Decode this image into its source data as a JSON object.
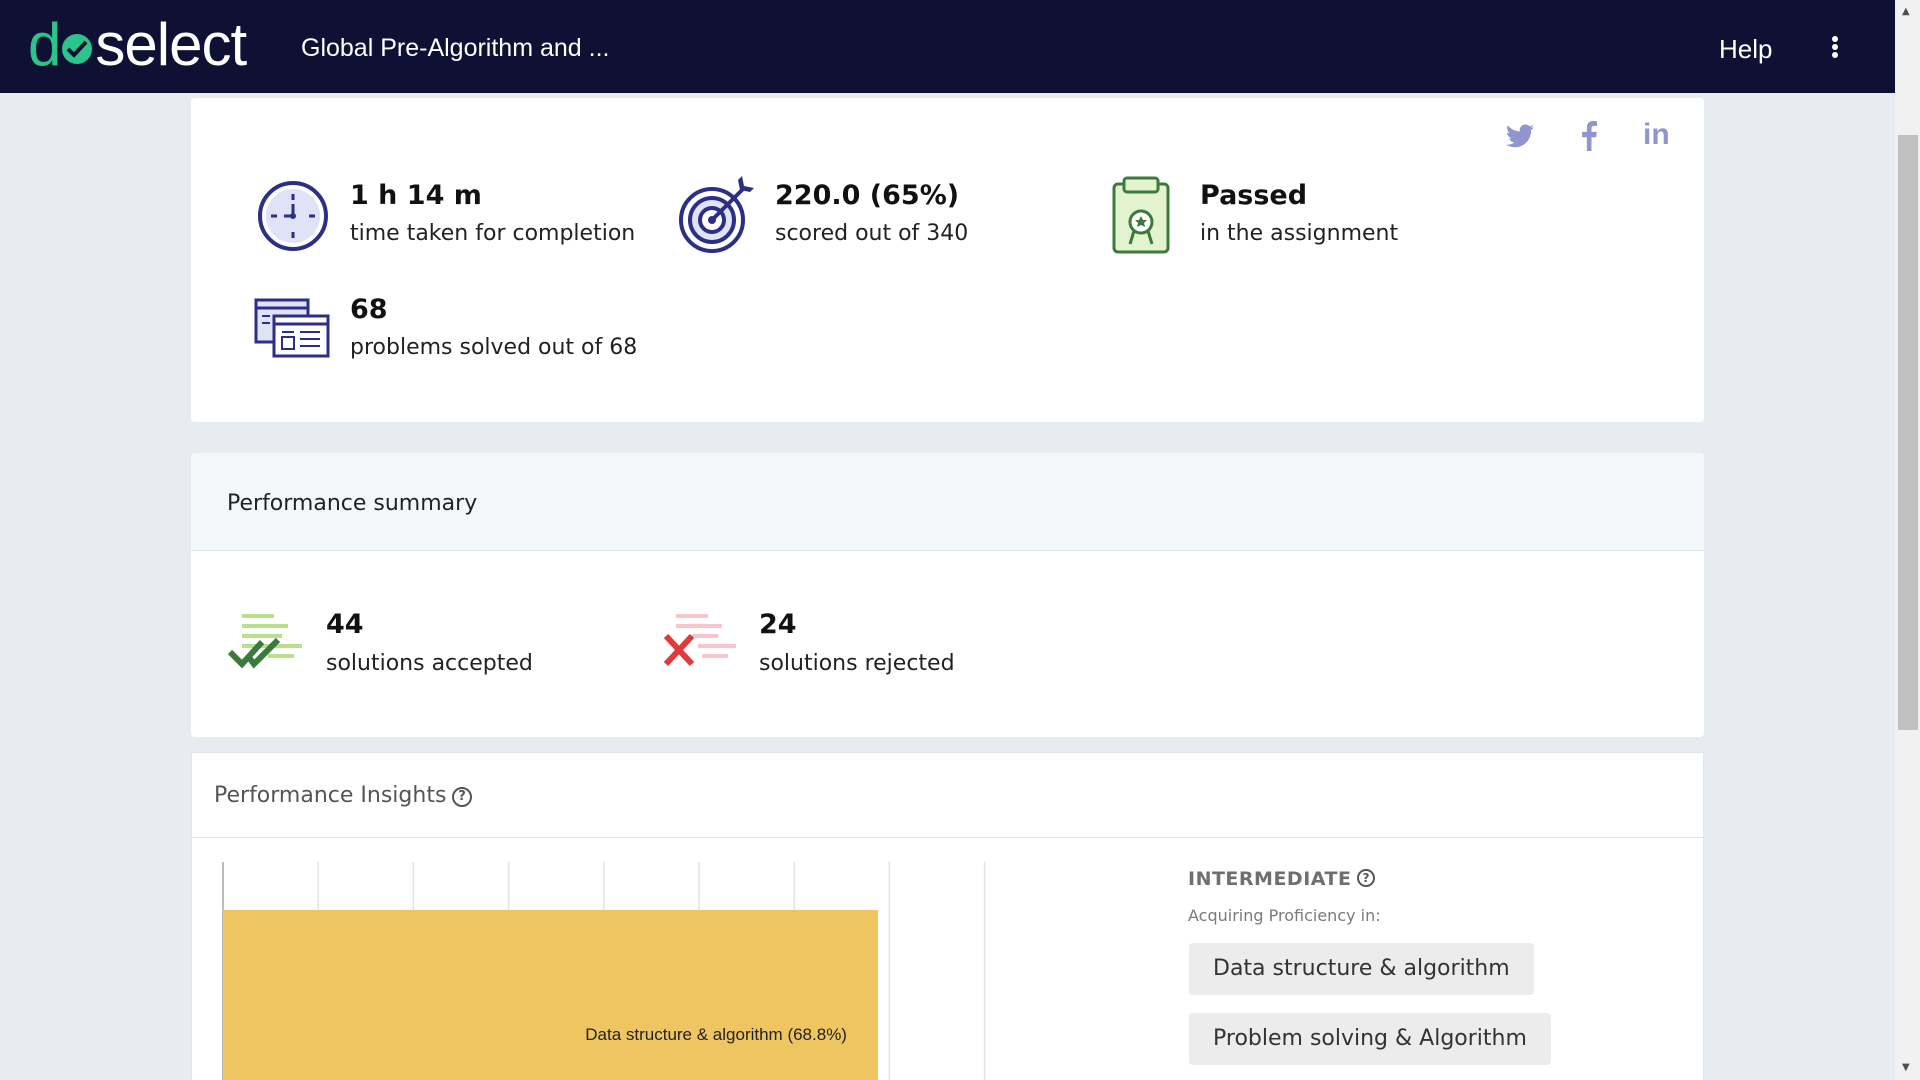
{
  "header": {
    "logo_prefix": "d",
    "logo_suffix": "select",
    "title": "Global Pre-Algorithm and ...",
    "help_label": "Help",
    "menu_icon": "kebab-menu-icon"
  },
  "social": [
    "twitter-icon",
    "facebook-icon",
    "linkedin-icon"
  ],
  "stats": {
    "time": {
      "value": "1 h 14 m",
      "label": "time taken for completion",
      "icon": "clock-icon"
    },
    "score": {
      "value": "220.0 (65%)",
      "label": "scored out of 340",
      "icon": "target-icon"
    },
    "result": {
      "value": "Passed",
      "label": "in the assignment",
      "icon": "certificate-clipboard-icon"
    },
    "problems": {
      "value": "68",
      "label": "problems solved out of 68",
      "icon": "windows-icon"
    }
  },
  "performance_summary": {
    "title": "Performance summary",
    "accepted": {
      "value": "44",
      "label": "solutions accepted"
    },
    "rejected": {
      "value": "24",
      "label": "solutions rejected"
    }
  },
  "insights": {
    "title": "Performance Insights",
    "level": "INTERMEDIATE",
    "subtitle": "Acquiring Proficiency in:",
    "chips": [
      "Data structure & algorithm",
      "Problem solving & Algorithm"
    ]
  },
  "chart_data": {
    "type": "bar",
    "orientation": "horizontal",
    "categories": [
      "Data structure & algorithm"
    ],
    "values": [
      68.8
    ],
    "data_labels": [
      "Data structure & algorithm (68.8%)"
    ],
    "xlim": [
      0,
      100
    ],
    "grid": true,
    "colors": [
      "#efc562"
    ]
  },
  "colors": {
    "header_bg": "#0e1133",
    "brand_green": "#2bc48a",
    "icon_navy": "#2b2f86",
    "bar": "#efc562"
  }
}
